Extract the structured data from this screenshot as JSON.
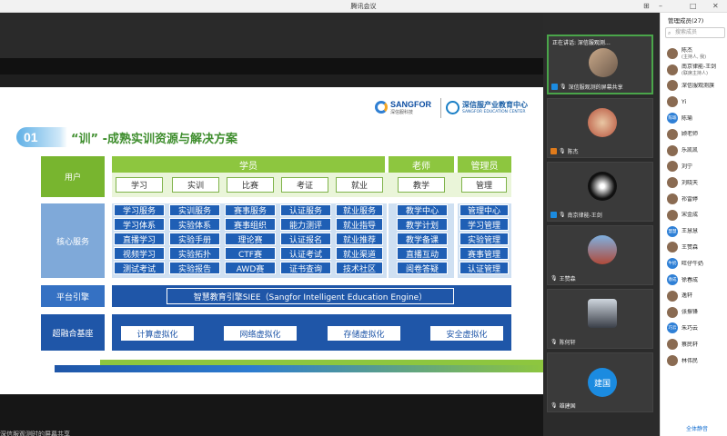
{
  "window": {
    "title": "腾讯会议"
  },
  "slide": {
    "logo_sangfor": "SANGFOR",
    "logo_sangfor_sub": "深信服科技",
    "logo_edu": "深信服产业教育中心",
    "logo_edu_sub": "SANGFOR EDUCATION CENTER",
    "section_number": "01",
    "section_title": "“训” -成熟实训资源与解决方案",
    "header": {
      "student": "学员",
      "teacher": "老师",
      "admin": "管理员"
    },
    "row_labels": {
      "user": "用户",
      "core": "核心服务",
      "engine": "平台引擎",
      "infra": "超融合基座"
    },
    "user_row": [
      "学习",
      "实训",
      "比赛",
      "考证",
      "就业",
      "教学",
      "管理"
    ],
    "core_columns": [
      {
        "title": "学习服务",
        "items": [
          "学习体系",
          "直播学习",
          "视频学习",
          "测试考试"
        ]
      },
      {
        "title": "实训服务",
        "items": [
          "实验体系",
          "实验手册",
          "实验拓扑",
          "实验报告"
        ]
      },
      {
        "title": "赛事服务",
        "items": [
          "赛事组织",
          "理论赛",
          "CTF赛",
          "AWD赛"
        ]
      },
      {
        "title": "认证服务",
        "items": [
          "能力测评",
          "认证报名",
          "认证考试",
          "证书查询"
        ]
      },
      {
        "title": "就业服务",
        "items": [
          "就业指导",
          "就业推荐",
          "就业渠道",
          "技术社区"
        ]
      },
      {
        "title": "教学中心",
        "items": [
          "教学计划",
          "教学备课",
          "直播互动",
          "阅卷答疑"
        ]
      },
      {
        "title": "管理中心",
        "items": [
          "学习管理",
          "实验管理",
          "赛事管理",
          "认证管理"
        ]
      }
    ],
    "engine": "智慧教育引擎SIEE（Sangfor Intelligent Education Engine）",
    "infra": [
      "计算虚拟化",
      "网络虚拟化",
      "存储虚拟化",
      "安全虚拟化"
    ]
  },
  "share_banner": "深信服观测时的屏幕共享",
  "video_tiles": {
    "speaking": "正在讲话: 深信服观测…",
    "labels": [
      "深信服观测的屏幕共享",
      "陈杰",
      "南京律能-王剑",
      "王赞森",
      "陈何轩",
      "雄建国"
    ],
    "avatar_text": "建国"
  },
  "members": {
    "title": "管理成员(27)",
    "search_placeholder": "搜索成员",
    "list": [
      {
        "name": "陈杰",
        "role": "(主持人, 我)",
        "avatar": ""
      },
      {
        "name": "南京律能-王剑",
        "role": "(联席主持人)",
        "avatar": ""
      },
      {
        "name": "深信服观测旗",
        "role": "",
        "avatar": ""
      },
      {
        "name": "Yi",
        "role": "",
        "avatar": ""
      },
      {
        "name": "陈瑜",
        "role": "",
        "avatar": "陈瑜"
      },
      {
        "name": "顾老师",
        "role": "",
        "avatar": ""
      },
      {
        "name": "乐凯凯",
        "role": "",
        "avatar": ""
      },
      {
        "name": "刘宁",
        "role": "",
        "avatar": ""
      },
      {
        "name": "刘晓天",
        "role": "",
        "avatar": ""
      },
      {
        "name": "祁雷婷",
        "role": "",
        "avatar": ""
      },
      {
        "name": "宋金成",
        "role": "",
        "avatar": ""
      },
      {
        "name": "王慧慧",
        "role": "",
        "avatar": "慧慧"
      },
      {
        "name": "王赞森",
        "role": "",
        "avatar": ""
      },
      {
        "name": "旺仔牛奶",
        "role": "",
        "avatar": "牛奶"
      },
      {
        "name": "徐春成",
        "role": "",
        "avatar": "春成"
      },
      {
        "name": "逸轩",
        "role": "",
        "avatar": ""
      },
      {
        "name": "张振锋",
        "role": "",
        "avatar": ""
      },
      {
        "name": "朱巧云",
        "role": "",
        "avatar": "巧云"
      },
      {
        "name": "蔡民轩",
        "role": "",
        "avatar": ""
      },
      {
        "name": "林伟民",
        "role": "",
        "avatar": ""
      }
    ],
    "mute_all": "全体静音"
  },
  "colors": {
    "green": "#8dc63f",
    "blue": "#1f56a8",
    "accent": "#1b8be0"
  }
}
